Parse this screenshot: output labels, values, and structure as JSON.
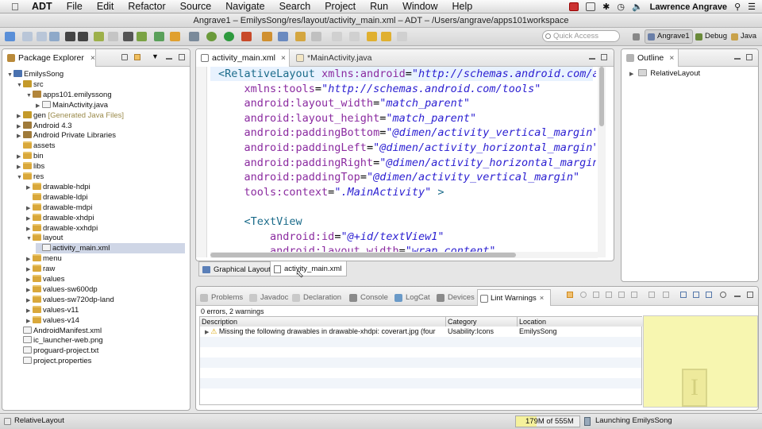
{
  "menubar": {
    "app_name": "ADT",
    "items": [
      "File",
      "Edit",
      "Refactor",
      "Source",
      "Navigate",
      "Search",
      "Project",
      "Run",
      "Window",
      "Help"
    ],
    "user": "Lawrence Angrave"
  },
  "window_title": "Angrave1 – EmilysSong/res/layout/activity_main.xml – ADT – /Users/angrave/apps101workspace",
  "quick_access": {
    "placeholder": "Quick Access"
  },
  "perspectives": {
    "angrave": "Angrave1",
    "debug": "Debug",
    "java": "Java"
  },
  "package_explorer": {
    "title": "Package Explorer",
    "tree": [
      {
        "label": "EmilysSong",
        "depth": 0,
        "twisty": "▼",
        "icon": "project-icon"
      },
      {
        "label": "src",
        "depth": 1,
        "twisty": "▼",
        "icon": "src-folder-icon"
      },
      {
        "label": "apps101.emilyssong",
        "depth": 2,
        "twisty": "▼",
        "icon": "package-icon"
      },
      {
        "label": "MainActivity.java",
        "depth": 3,
        "twisty": "▶",
        "icon": "java-file-icon"
      },
      {
        "label": "gen",
        "depth": 1,
        "twisty": "▶",
        "icon": "src-folder-icon",
        "suffix": "[Generated Java Files]"
      },
      {
        "label": "Android 4.3",
        "depth": 1,
        "twisty": "▶",
        "icon": "library-icon"
      },
      {
        "label": "Android Private Libraries",
        "depth": 1,
        "twisty": "▶",
        "icon": "library-icon"
      },
      {
        "label": "assets",
        "depth": 1,
        "twisty": "",
        "icon": "folder-icon"
      },
      {
        "label": "bin",
        "depth": 1,
        "twisty": "▶",
        "icon": "folder-icon"
      },
      {
        "label": "libs",
        "depth": 1,
        "twisty": "▶",
        "icon": "folder-icon"
      },
      {
        "label": "res",
        "depth": 1,
        "twisty": "▼",
        "icon": "folder-icon"
      },
      {
        "label": "drawable-hdpi",
        "depth": 2,
        "twisty": "▶",
        "icon": "folder-icon"
      },
      {
        "label": "drawable-ldpi",
        "depth": 2,
        "twisty": "",
        "icon": "folder-icon"
      },
      {
        "label": "drawable-mdpi",
        "depth": 2,
        "twisty": "▶",
        "icon": "folder-icon"
      },
      {
        "label": "drawable-xhdpi",
        "depth": 2,
        "twisty": "▶",
        "icon": "folder-icon"
      },
      {
        "label": "drawable-xxhdpi",
        "depth": 2,
        "twisty": "▶",
        "icon": "folder-icon"
      },
      {
        "label": "layout",
        "depth": 2,
        "twisty": "▼",
        "icon": "folder-icon"
      },
      {
        "label": "activity_main.xml",
        "depth": 3,
        "twisty": "",
        "icon": "xml-file-icon",
        "selected": true
      },
      {
        "label": "menu",
        "depth": 2,
        "twisty": "▶",
        "icon": "folder-icon"
      },
      {
        "label": "raw",
        "depth": 2,
        "twisty": "▶",
        "icon": "folder-icon"
      },
      {
        "label": "values",
        "depth": 2,
        "twisty": "▶",
        "icon": "folder-icon"
      },
      {
        "label": "values-sw600dp",
        "depth": 2,
        "twisty": "▶",
        "icon": "folder-icon"
      },
      {
        "label": "values-sw720dp-land",
        "depth": 2,
        "twisty": "▶",
        "icon": "folder-icon"
      },
      {
        "label": "values-v11",
        "depth": 2,
        "twisty": "▶",
        "icon": "folder-icon"
      },
      {
        "label": "values-v14",
        "depth": 2,
        "twisty": "▶",
        "icon": "folder-icon"
      },
      {
        "label": "AndroidManifest.xml",
        "depth": 1,
        "twisty": "",
        "icon": "xml-file-icon"
      },
      {
        "label": "ic_launcher-web.png",
        "depth": 1,
        "twisty": "",
        "icon": "image-file-icon"
      },
      {
        "label": "proguard-project.txt",
        "depth": 1,
        "twisty": "",
        "icon": "text-file-icon"
      },
      {
        "label": "project.properties",
        "depth": 1,
        "twisty": "",
        "icon": "text-file-icon"
      }
    ]
  },
  "editor": {
    "tabs": [
      {
        "label": "activity_main.xml",
        "active": true
      },
      {
        "label": "*MainActivity.java",
        "active": false
      }
    ],
    "lines": [
      [
        {
          "t": "<",
          "c": "tag"
        },
        {
          "t": "RelativeLayout",
          "c": "tag"
        },
        {
          "t": " ",
          "c": "plain"
        },
        {
          "t": "xmlns:android",
          "c": "attr"
        },
        {
          "t": "=",
          "c": "plain"
        },
        {
          "t": "\"http://schemas.android.com/a",
          "c": "val"
        }
      ],
      [
        {
          "t": "    xmlns:tools",
          "c": "attr"
        },
        {
          "t": "=",
          "c": "plain"
        },
        {
          "t": "\"http://schemas.android.com/tools\"",
          "c": "val"
        }
      ],
      [
        {
          "t": "    android:layout_width",
          "c": "attr"
        },
        {
          "t": "=",
          "c": "plain"
        },
        {
          "t": "\"match_parent\"",
          "c": "val"
        }
      ],
      [
        {
          "t": "    android:layout_height",
          "c": "attr"
        },
        {
          "t": "=",
          "c": "plain"
        },
        {
          "t": "\"match_parent\"",
          "c": "val"
        }
      ],
      [
        {
          "t": "    android:paddingBottom",
          "c": "attr"
        },
        {
          "t": "=",
          "c": "plain"
        },
        {
          "t": "\"@dimen/activity_vertical_margin\"",
          "c": "val"
        }
      ],
      [
        {
          "t": "    android:paddingLeft",
          "c": "attr"
        },
        {
          "t": "=",
          "c": "plain"
        },
        {
          "t": "\"@dimen/activity_horizontal_margin\"",
          "c": "val"
        }
      ],
      [
        {
          "t": "    android:paddingRight",
          "c": "attr"
        },
        {
          "t": "=",
          "c": "plain"
        },
        {
          "t": "\"@dimen/activity_horizontal_margin\"",
          "c": "val"
        }
      ],
      [
        {
          "t": "    android:paddingTop",
          "c": "attr"
        },
        {
          "t": "=",
          "c": "plain"
        },
        {
          "t": "\"@dimen/activity_vertical_margin\"",
          "c": "val"
        }
      ],
      [
        {
          "t": "    tools:context",
          "c": "attr"
        },
        {
          "t": "=",
          "c": "plain"
        },
        {
          "t": "\".MainActivity\"",
          "c": "val"
        },
        {
          "t": " >",
          "c": "tag"
        }
      ],
      [
        {
          "t": "",
          "c": "plain"
        }
      ],
      [
        {
          "t": "    <TextView",
          "c": "tag"
        }
      ],
      [
        {
          "t": "        android:id",
          "c": "attr"
        },
        {
          "t": "=",
          "c": "plain"
        },
        {
          "t": "\"@+id/textView1\"",
          "c": "val"
        }
      ],
      [
        {
          "t": "        android:layout_width",
          "c": "attr"
        },
        {
          "t": "=",
          "c": "plain"
        },
        {
          "t": "\"wrap_content\"",
          "c": "val"
        }
      ]
    ],
    "bottom_tabs": [
      {
        "label": "Graphical Layout",
        "active": false
      },
      {
        "label": "activity_main.xml",
        "active": true
      }
    ]
  },
  "outline": {
    "title": "Outline",
    "root": "RelativeLayout"
  },
  "bottom_panel": {
    "tabs": [
      "Problems",
      "Javadoc",
      "Declaration",
      "Console",
      "LogCat",
      "Devices",
      "Lint Warnings"
    ],
    "active_tab": "Lint Warnings",
    "summary": "0 errors, 2 warnings",
    "columns": [
      "Description",
      "Category",
      "Location"
    ],
    "rows": [
      {
        "description": "Missing the following drawables in drawable-xhdpi: coverart.jpg (four",
        "category": "Usability:Icons",
        "location": "EmilysSong"
      }
    ]
  },
  "statusbar": {
    "left": "RelativeLayout",
    "heap": "179M of 555M",
    "heap_fraction": 0.32,
    "launch": "Launching EmilysSong"
  },
  "colors": {
    "accent_selection": "#cfd6e6",
    "preview_bg": "#f7f6b0"
  }
}
